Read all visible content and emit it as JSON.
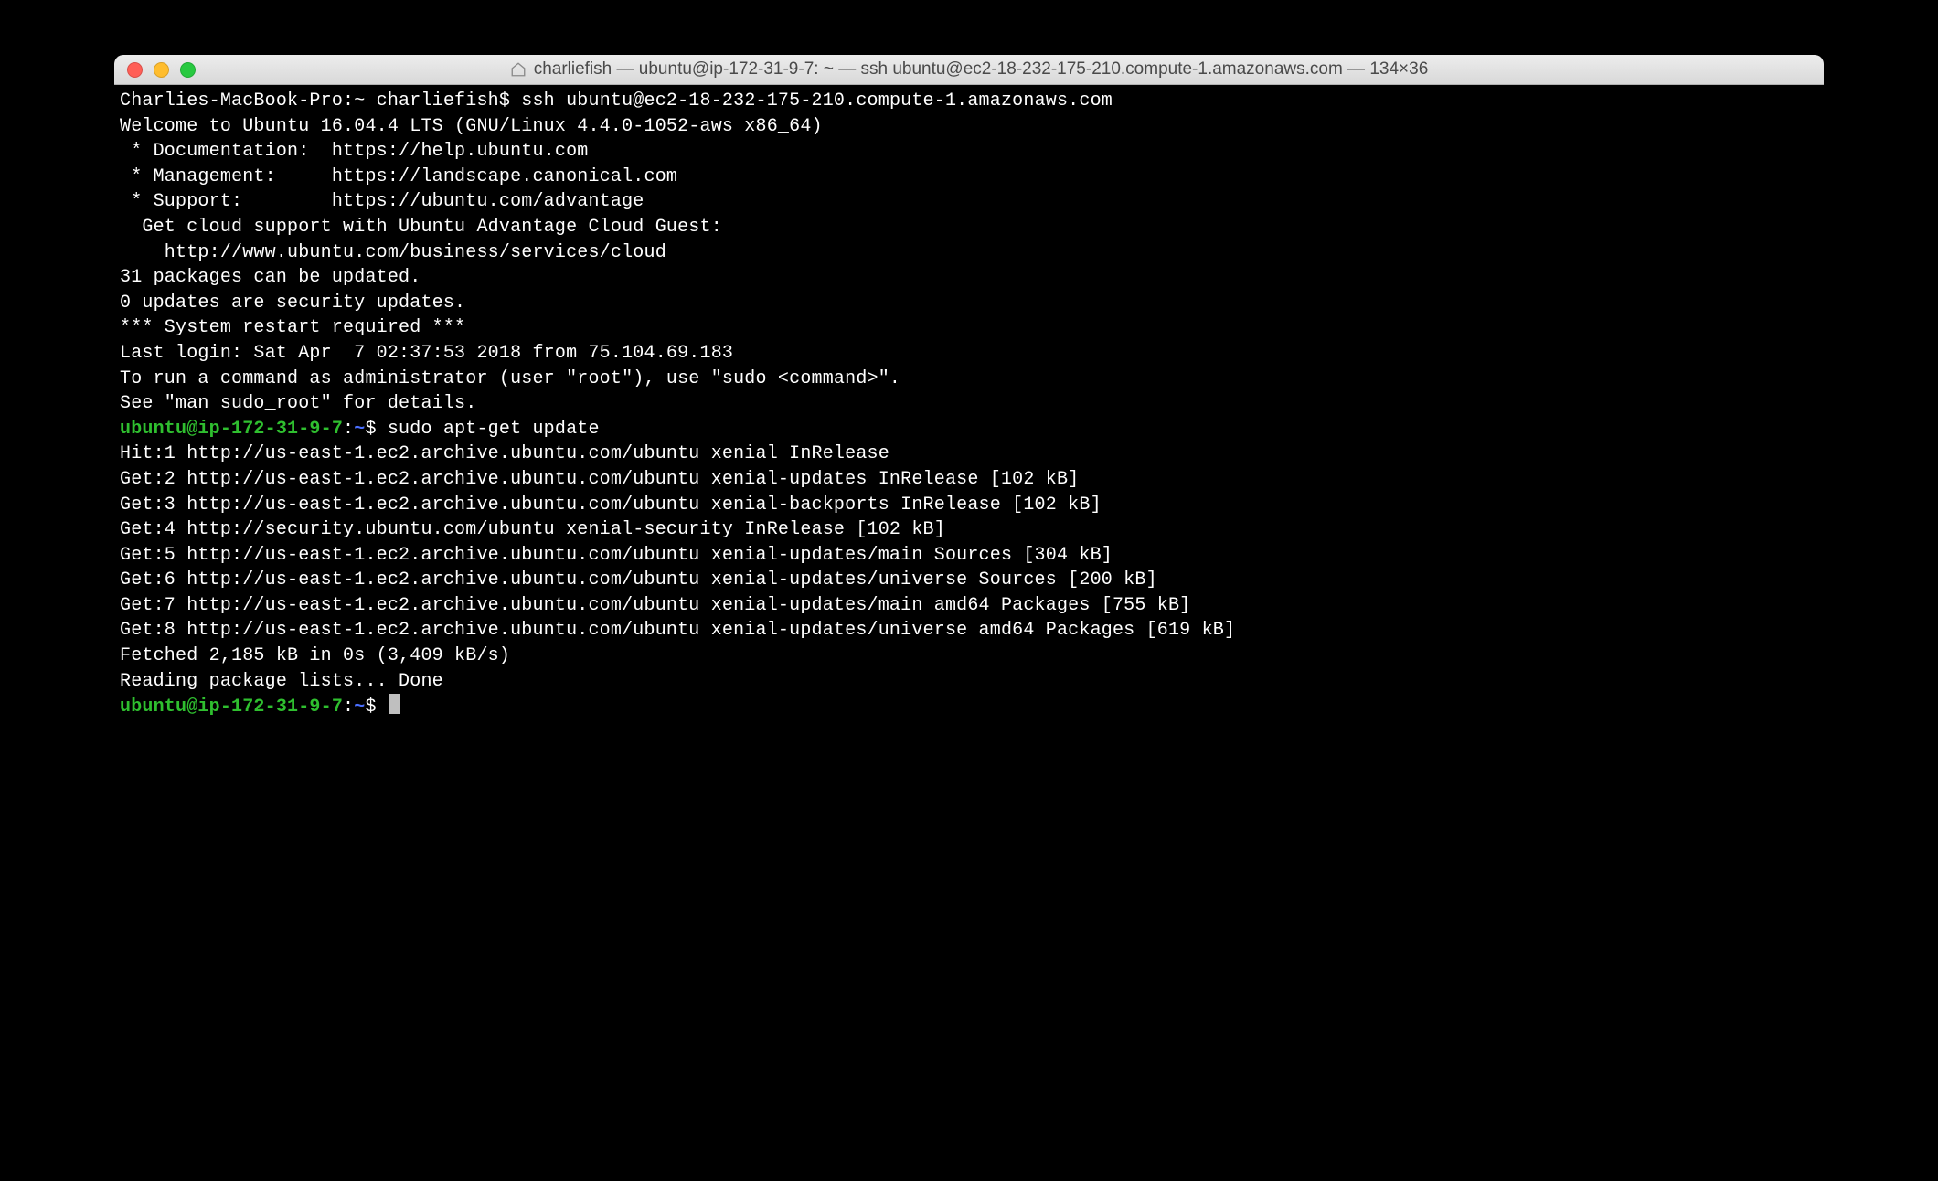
{
  "window": {
    "title": "charliefish — ubuntu@ip-172-31-9-7: ~ — ssh ubuntu@ec2-18-232-175-210.compute-1.amazonaws.com — 134×36"
  },
  "session": {
    "local_prompt": "Charlies-MacBook-Pro:~ charliefish$ ",
    "ssh_cmd": "ssh ubuntu@ec2-18-232-175-210.compute-1.amazonaws.com",
    "motd": [
      "Welcome to Ubuntu 16.04.4 LTS (GNU/Linux 4.4.0-1052-aws x86_64)",
      "",
      " * Documentation:  https://help.ubuntu.com",
      " * Management:     https://landscape.canonical.com",
      " * Support:        https://ubuntu.com/advantage",
      "",
      "  Get cloud support with Ubuntu Advantage Cloud Guest:",
      "    http://www.ubuntu.com/business/services/cloud",
      "",
      "31 packages can be updated.",
      "0 updates are security updates.",
      "",
      "",
      "*** System restart required ***",
      "Last login: Sat Apr  7 02:37:53 2018 from 75.104.69.183",
      "To run a command as administrator (user \"root\"), use \"sudo <command>\".",
      "See \"man sudo_root\" for details.",
      ""
    ],
    "remote_user_host": "ubuntu@ip-172-31-9-7",
    "remote_path_sep": ":",
    "remote_path": "~",
    "remote_prompt_sym": "$ ",
    "cmd1": "sudo apt-get update",
    "apt_output": [
      "Hit:1 http://us-east-1.ec2.archive.ubuntu.com/ubuntu xenial InRelease",
      "Get:2 http://us-east-1.ec2.archive.ubuntu.com/ubuntu xenial-updates InRelease [102 kB]",
      "Get:3 http://us-east-1.ec2.archive.ubuntu.com/ubuntu xenial-backports InRelease [102 kB]",
      "Get:4 http://security.ubuntu.com/ubuntu xenial-security InRelease [102 kB]",
      "Get:5 http://us-east-1.ec2.archive.ubuntu.com/ubuntu xenial-updates/main Sources [304 kB]",
      "Get:6 http://us-east-1.ec2.archive.ubuntu.com/ubuntu xenial-updates/universe Sources [200 kB]",
      "Get:7 http://us-east-1.ec2.archive.ubuntu.com/ubuntu xenial-updates/main amd64 Packages [755 kB]",
      "Get:8 http://us-east-1.ec2.archive.ubuntu.com/ubuntu xenial-updates/universe amd64 Packages [619 kB]",
      "Fetched 2,185 kB in 0s (3,409 kB/s)",
      "Reading package lists... Done"
    ]
  }
}
